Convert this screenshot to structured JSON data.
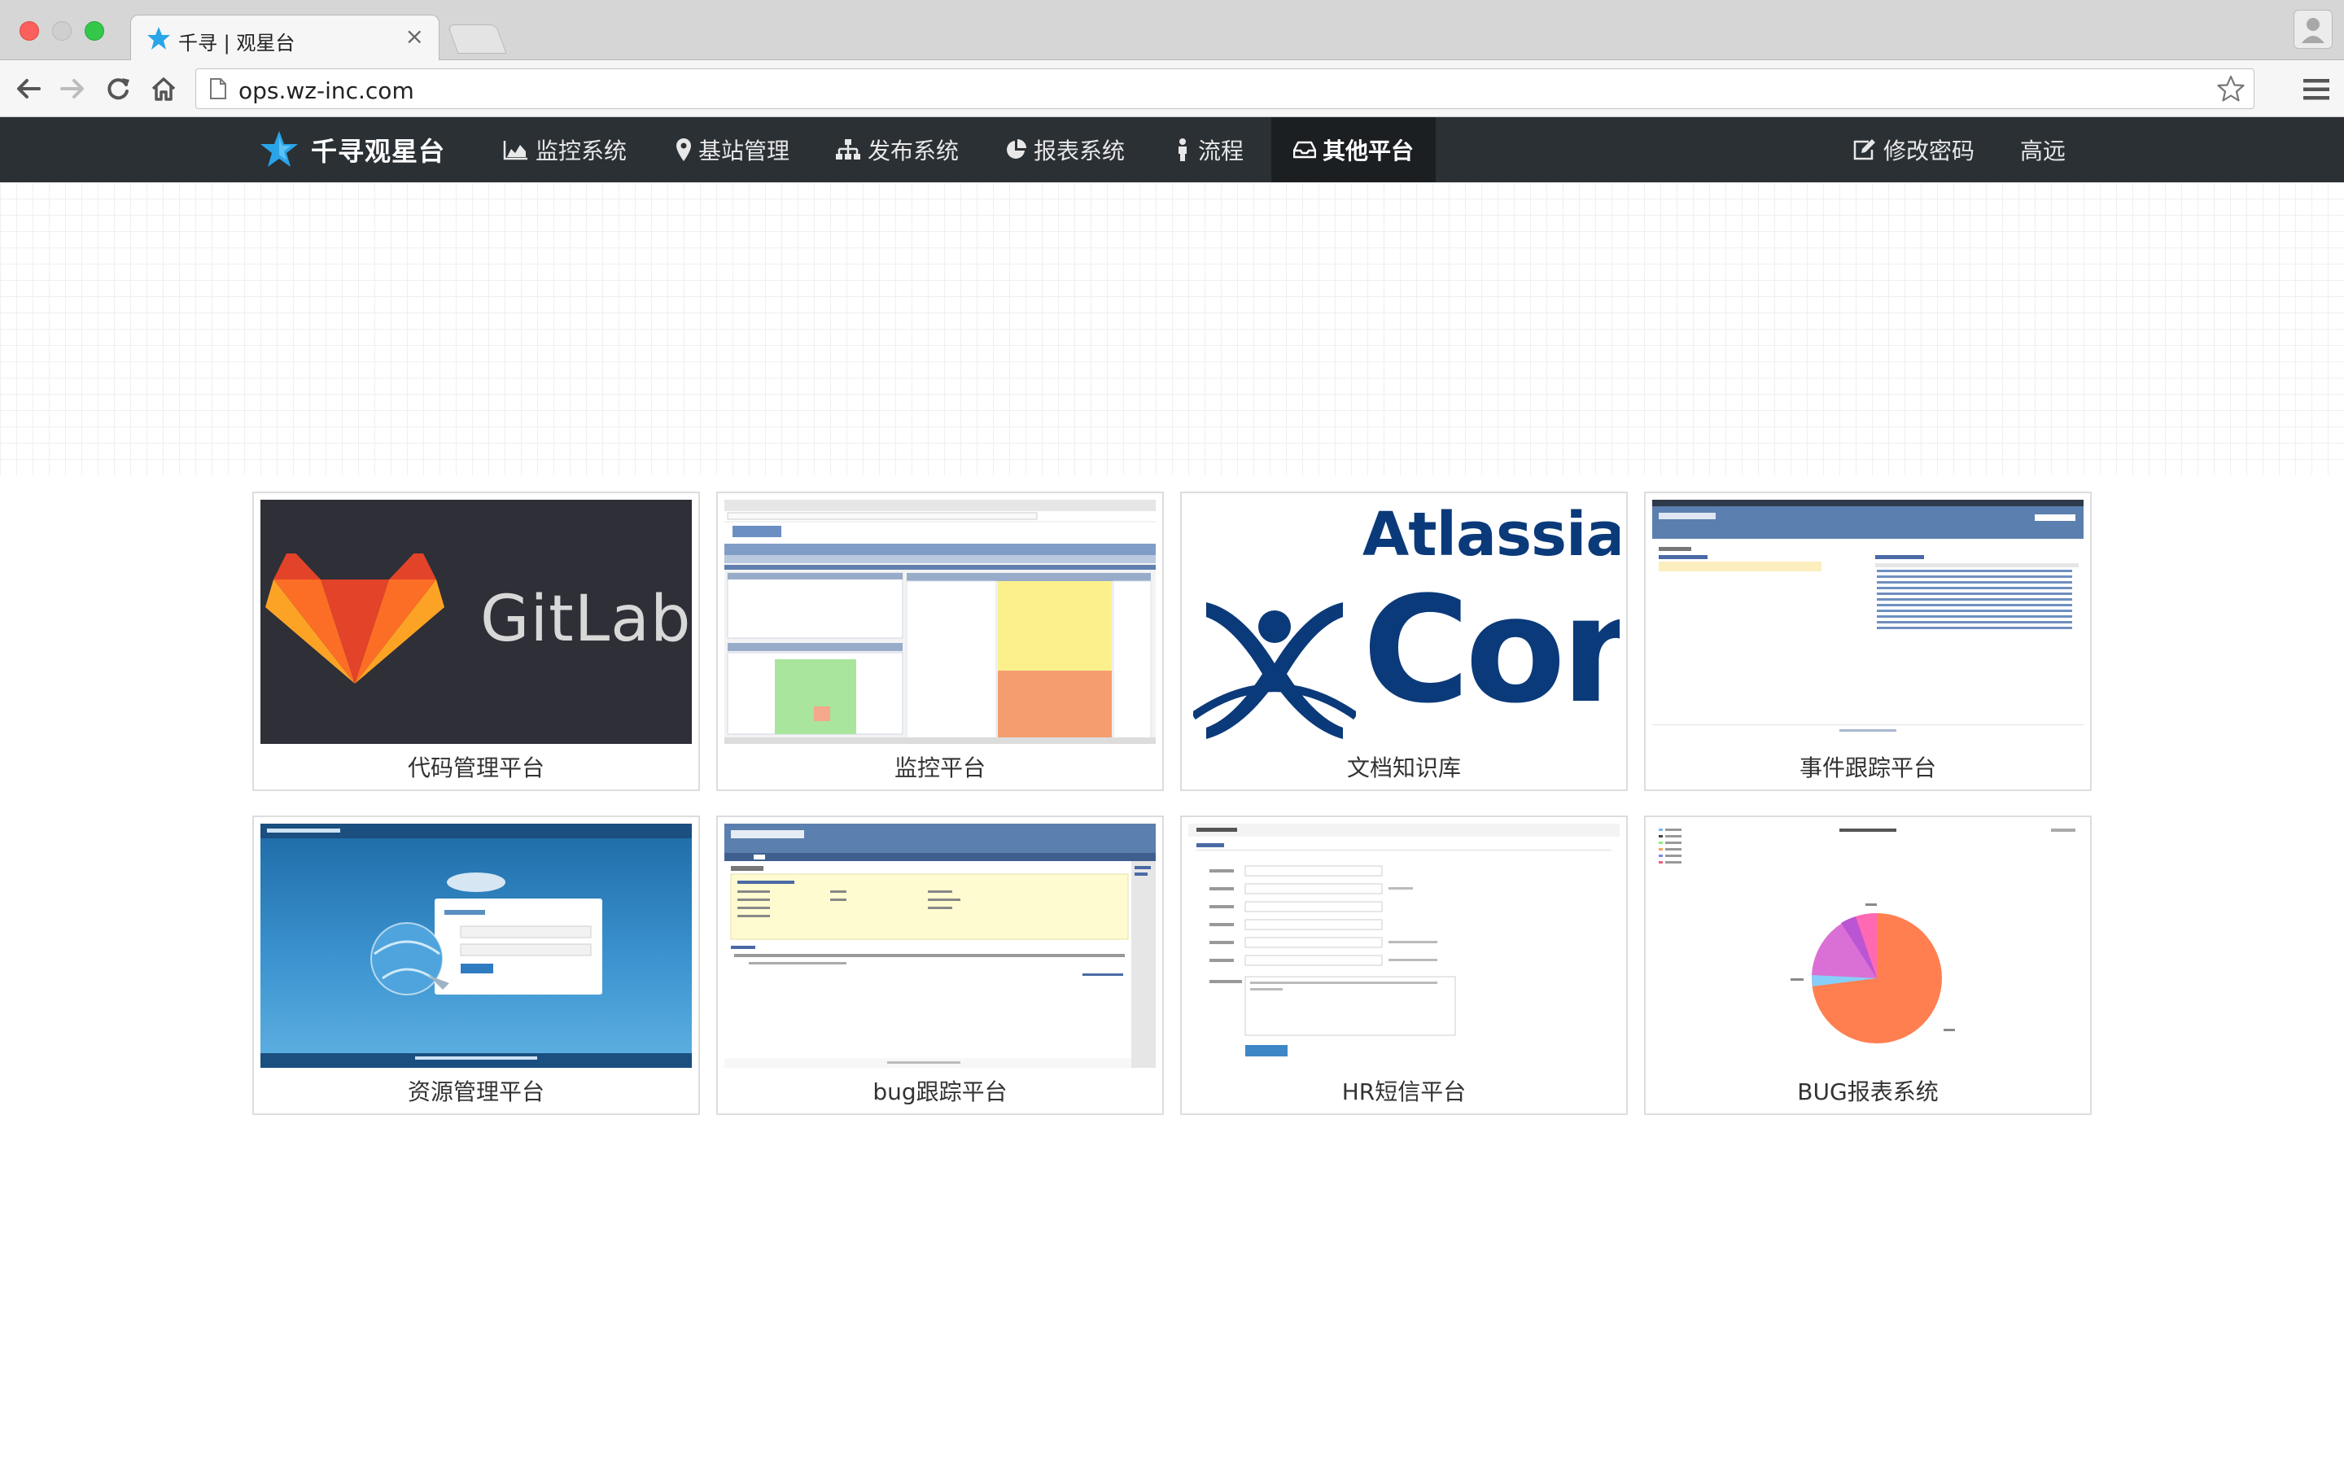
{
  "browser": {
    "tab_title": "千寻 | 观星台",
    "tab_close": "×",
    "address": "ops.wz-inc.com"
  },
  "navbar": {
    "brand": "千寻观星台",
    "items": [
      {
        "label": "监控系统",
        "icon": "area-chart-icon"
      },
      {
        "label": "基站管理",
        "icon": "map-marker-icon"
      },
      {
        "label": "发布系统",
        "icon": "sitemap-icon"
      },
      {
        "label": "报表系统",
        "icon": "pie-chart-icon"
      },
      {
        "label": "流程",
        "icon": "person-icon"
      },
      {
        "label": "其他平台",
        "icon": "inbox-icon",
        "active": true
      }
    ],
    "right_items": [
      {
        "label": "修改密码",
        "icon": "edit-icon"
      },
      {
        "label": "高远"
      }
    ]
  },
  "cards": [
    {
      "label": "代码管理平台",
      "thumb": "gitlab",
      "thumb_text": "GitLab"
    },
    {
      "label": "监控平台",
      "thumb": "monitor"
    },
    {
      "label": "文档知识库",
      "thumb": "atlassian",
      "thumb_text": "Atlassian",
      "thumb_text2": "Con"
    },
    {
      "label": "事件跟踪平台",
      "thumb": "event"
    },
    {
      "label": "资源管理平台",
      "thumb": "resource"
    },
    {
      "label": "bug跟踪平台",
      "thumb": "bugtrack"
    },
    {
      "label": "HR短信平台",
      "thumb": "hr"
    },
    {
      "label": "BUG报表系统",
      "thumb": "bugreport"
    }
  ],
  "colors": {
    "navbar_bg": "#2b3035",
    "navbar_active_bg": "#1c1f22",
    "brand_star": "#2aa4e8"
  }
}
